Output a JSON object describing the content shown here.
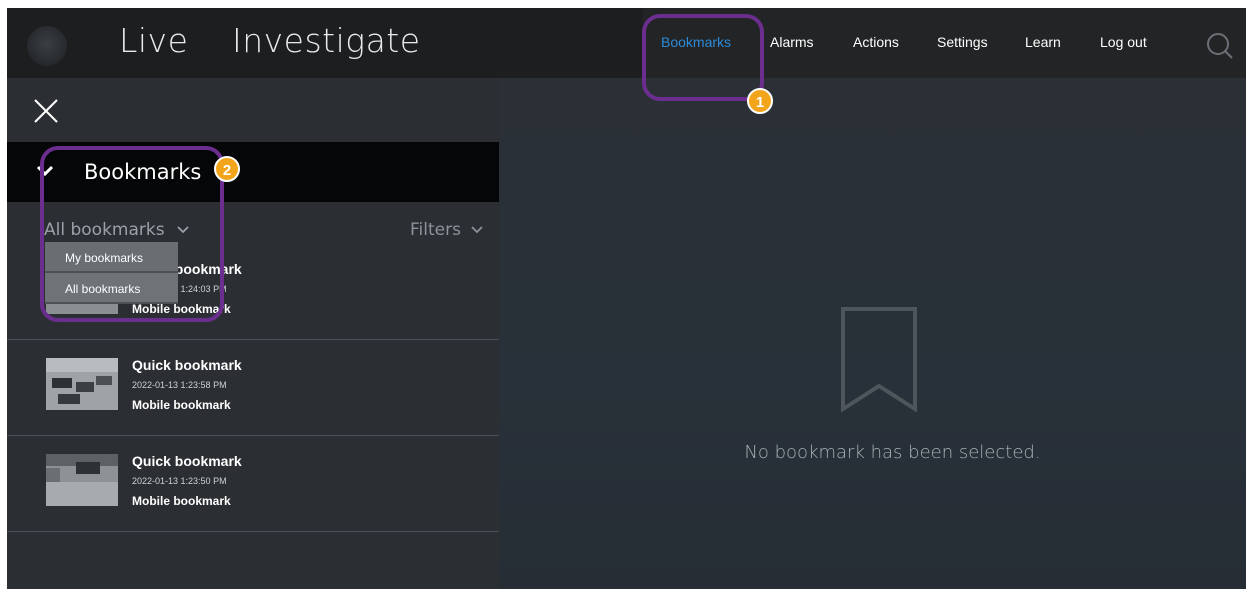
{
  "topbar": {
    "tabs": [
      {
        "label": "Live"
      },
      {
        "label": "Investigate"
      }
    ],
    "nav": [
      {
        "label": "Bookmarks",
        "active": true
      },
      {
        "label": "Alarms"
      },
      {
        "label": "Actions"
      },
      {
        "label": "Settings"
      },
      {
        "label": "Learn"
      },
      {
        "label": "Log out"
      }
    ],
    "search_icon": "search-icon",
    "accent": "#2d8bd8"
  },
  "panel": {
    "close_icon": "close-icon",
    "title": "Bookmarks",
    "scope_label": "All bookmarks",
    "filters_label": "Filters",
    "dropdown": {
      "options": [
        "My bookmarks",
        "All bookmarks"
      ]
    },
    "items": [
      {
        "title": "Quick bookmark",
        "time": "2022-01-13 1:24:03 PM",
        "desc": "Mobile bookmark"
      },
      {
        "title": "Quick bookmark",
        "time": "2022-01-13 1:23:58 PM",
        "desc": "Mobile bookmark"
      },
      {
        "title": "Quick bookmark",
        "time": "2022-01-13 1:23:50 PM",
        "desc": "Mobile bookmark"
      }
    ]
  },
  "detail": {
    "empty_icon": "bookmark-icon",
    "empty_text": "No bookmark has been selected."
  },
  "callouts": [
    {
      "label": "1",
      "color": "#f2a51a"
    },
    {
      "label": "2",
      "color": "#f2a51a"
    }
  ],
  "outline_color": "#6b2d8e"
}
